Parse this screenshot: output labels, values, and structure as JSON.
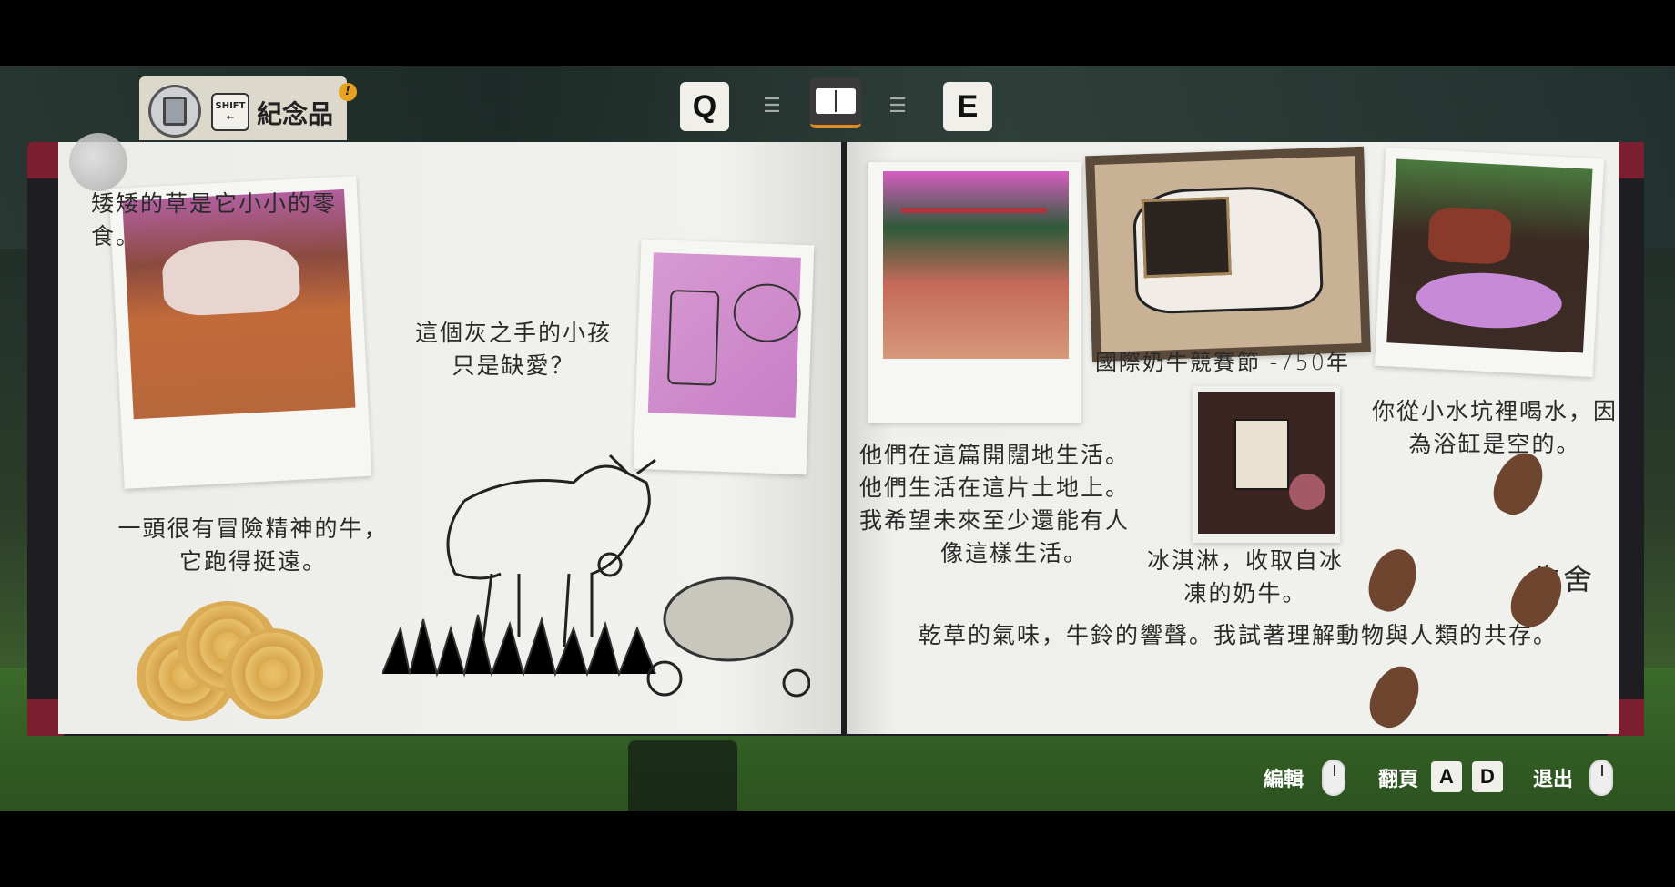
{
  "topbar": {
    "memento_label": "紀念品",
    "shift_key": "SHIFT",
    "shift_arrow": "←",
    "alert": "!",
    "prev_key": "Q",
    "next_key": "E"
  },
  "left_page": {
    "caption_grass": "矮矮的草是它小小的零食。",
    "caption_child": "這個灰之手的小孩只是缺愛？",
    "caption_cow": "一頭很有冒險精神的牛，它跑得挺遠。"
  },
  "right_page": {
    "caption_festival": "國際奶牛競賽節 -750年",
    "caption_puddle": "你從小水坑裡喝水，因為浴缸是空的。",
    "caption_land_1": "他們在這篇開闊地生活。",
    "caption_land_2": "他們生活在這片土地上。",
    "caption_land_3": "我希望未來至少還能有人",
    "caption_land_4": "像這樣生活。",
    "caption_icecream": "冰淇淋，收取自冰凍的奶牛。",
    "caption_barn": "牛舍",
    "caption_bottom": "乾草的氣味，牛鈴的響聲。我試著理解動物與人類的共存。"
  },
  "controls": {
    "edit_label": "編輯",
    "flip_label": "翻頁",
    "key_a": "A",
    "key_d": "D",
    "exit_label": "退出"
  }
}
